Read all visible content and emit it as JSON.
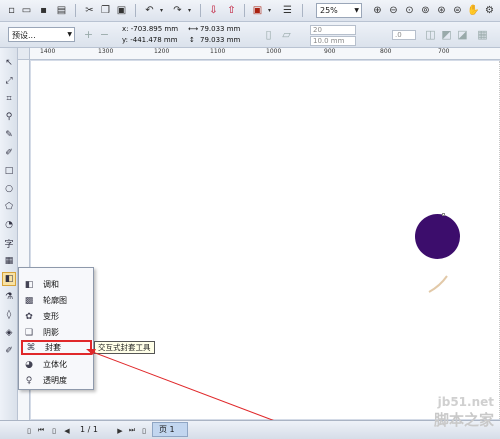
{
  "toolbar": {
    "zoom": "25%",
    "icons": [
      "new-icon",
      "open-icon",
      "save-icon",
      "print-icon",
      "cut-icon",
      "copy-icon",
      "paste-icon",
      "undo-icon",
      "redo-icon",
      "import-icon",
      "export-icon",
      "app-launcher-icon",
      "options-icon",
      "zoom-in-icon",
      "zoom-out-icon",
      "zoom-fit-icon",
      "zoom-page-icon",
      "zoom-width-icon",
      "zoom-height-icon",
      "pan-icon",
      "settings-icon"
    ]
  },
  "property_bar": {
    "preset": "预设...",
    "x": "x:  -703.895 mm",
    "y": "y:  -441.478 mm",
    "width": "79.033 mm",
    "height": "79.033 mm",
    "steps": "20",
    "offset": "10.0 mm",
    "angle": ".0"
  },
  "ruler": {
    "labels": [
      "1400",
      "1300",
      "1200",
      "1100",
      "1000",
      "900",
      "800",
      "700"
    ]
  },
  "flyout": {
    "items": [
      {
        "label": "调和",
        "icon": "blend-icon"
      },
      {
        "label": "轮廓图",
        "icon": "contour-icon"
      },
      {
        "label": "变形",
        "icon": "distort-icon"
      },
      {
        "label": "阴影",
        "icon": "shadow-icon"
      },
      {
        "label": "封套",
        "icon": "envelope-icon"
      },
      {
        "label": "立体化",
        "icon": "extrude-icon"
      },
      {
        "label": "透明度",
        "icon": "transparency-icon"
      }
    ]
  },
  "tooltip": "交互式封套工具",
  "status": {
    "page_count": "1 / 1",
    "page_tab": "页 1"
  },
  "watermark": {
    "url": "jb51.net",
    "text": "脚本之家"
  },
  "colors": {
    "circle": "#3c0d6c",
    "highlight": "#e0282a",
    "arrow": "#e0282a"
  }
}
